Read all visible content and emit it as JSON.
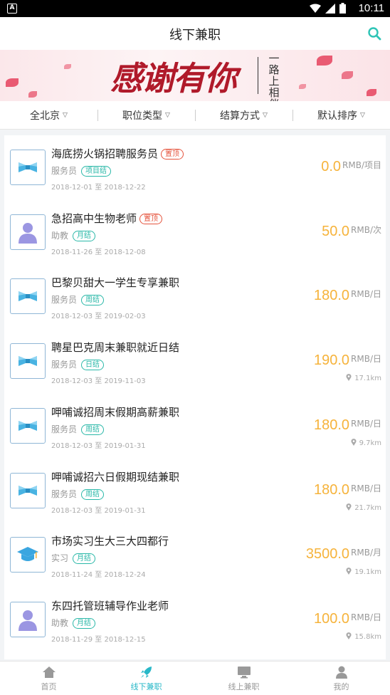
{
  "status_bar": {
    "app_icon_letter": "A",
    "time": "10:11"
  },
  "header": {
    "title": "线下兼职",
    "search_icon": "search-icon"
  },
  "banner": {
    "calligraphy": "感谢有你",
    "side_text": "一路上相伴"
  },
  "filters": [
    {
      "label": "全北京"
    },
    {
      "label": "职位类型"
    },
    {
      "label": "结算方式"
    },
    {
      "label": "默认排序"
    }
  ],
  "jobs": [
    {
      "title": "海底捞火锅招聘服务员",
      "pinned": "置顶",
      "role": "服务员",
      "settle": "项目结",
      "dates": "2018-12-01 至 2018-12-22",
      "price": "0.0",
      "unit": "RMB/项目",
      "distance": "",
      "logo": "bowtie-icon"
    },
    {
      "title": "急招高中生物老师",
      "pinned": "置顶",
      "role": "助教",
      "settle": "月结",
      "dates": "2018-11-26 至 2018-12-08",
      "price": "50.0",
      "unit": "RMB/次",
      "distance": "",
      "logo": "person-icon"
    },
    {
      "title": "巴黎贝甜大一学生专享兼职",
      "pinned": "",
      "role": "服务员",
      "settle": "周结",
      "dates": "2018-12-03 至 2019-02-03",
      "price": "180.0",
      "unit": "RMB/日",
      "distance": "",
      "logo": "bowtie-icon"
    },
    {
      "title": "聘星巴克周末兼职就近日结",
      "pinned": "",
      "role": "服务员",
      "settle": "日结",
      "dates": "2018-12-03 至 2019-11-03",
      "price": "190.0",
      "unit": "RMB/日",
      "distance": "17.1km",
      "logo": "bowtie-icon"
    },
    {
      "title": "呷哺诚招周末假期高薪兼职",
      "pinned": "",
      "role": "服务员",
      "settle": "周结",
      "dates": "2018-12-03 至 2019-01-31",
      "price": "180.0",
      "unit": "RMB/日",
      "distance": "9.7km",
      "logo": "bowtie-icon"
    },
    {
      "title": "呷哺诚招六日假期现结兼职",
      "pinned": "",
      "role": "服务员",
      "settle": "周结",
      "dates": "2018-12-03 至 2019-01-31",
      "price": "180.0",
      "unit": "RMB/日",
      "distance": "21.7km",
      "logo": "bowtie-icon"
    },
    {
      "title": "市场实习生大三大四都行",
      "pinned": "",
      "role": "实习",
      "settle": "月结",
      "dates": "2018-11-24 至 2018-12-24",
      "price": "3500.0",
      "unit": "RMB/月",
      "distance": "19.1km",
      "logo": "graduation-cap-icon"
    },
    {
      "title": "东四托管班辅导作业老师",
      "pinned": "",
      "role": "助教",
      "settle": "月结",
      "dates": "2018-11-29 至 2018-12-15",
      "price": "100.0",
      "unit": "RMB/日",
      "distance": "15.8km",
      "logo": "person-icon"
    }
  ],
  "nav": [
    {
      "label": "首页",
      "icon": "home-icon",
      "active": false
    },
    {
      "label": "线下兼职",
      "icon": "rocket-icon",
      "active": true
    },
    {
      "label": "线上兼职",
      "icon": "monitor-icon",
      "active": false
    },
    {
      "label": "我的",
      "icon": "user-icon",
      "active": false
    }
  ],
  "colors": {
    "accent": "#28b8c8",
    "price": "#f6b33b",
    "pinned": "#e5533c",
    "settle": "#2ab8a8"
  }
}
